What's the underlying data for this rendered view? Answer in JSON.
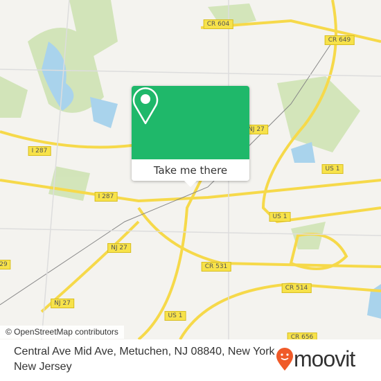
{
  "map": {
    "road_labels": [
      "CR 604",
      "CR 649",
      "NJ 27",
      "I 287",
      "US 1",
      "I 287",
      "US 1",
      "NJ 27",
      "CR 531",
      "29",
      "CR 514",
      "NJ 27",
      "US 1",
      "CR 656"
    ],
    "attribution": "© OpenStreetMap contributors"
  },
  "popup": {
    "icon": "location-pin-icon",
    "button_label": "Take me there",
    "color": "#1fb86a"
  },
  "footer": {
    "address": "Central Ave Mid Ave, Metuchen, NJ 08840, New York - New Jersey",
    "brand": "moovit",
    "brand_color": "#f05a28"
  }
}
